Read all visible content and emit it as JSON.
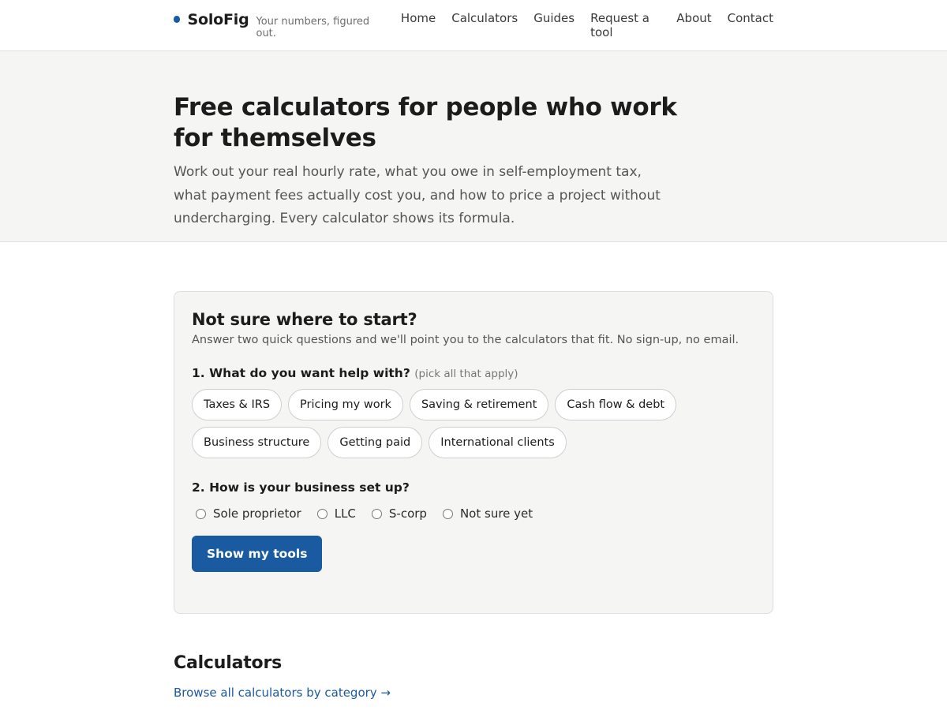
{
  "header": {
    "brand_name": "SoloFig",
    "tagline": "Your numbers, figured out.",
    "nav": [
      "Home",
      "Calculators",
      "Guides",
      "Request a tool",
      "About",
      "Contact"
    ]
  },
  "hero": {
    "title": "Free calculators for people who work for themselves",
    "description": "Work out your real hourly rate, what you owe in self-employment tax, what payment fees actually cost you, and how to price a project without undercharging. Every calculator shows its formula."
  },
  "finder": {
    "title": "Not sure where to start?",
    "subtitle": "Answer two quick questions and we'll point you to the calculators that fit. No sign-up, no email.",
    "q1_label": "1. What do you want help with?",
    "q1_hint": "(pick all that apply)",
    "topics": [
      "Taxes & IRS",
      "Pricing my work",
      "Saving & retirement",
      "Cash flow & debt",
      "Business structure",
      "Getting paid",
      "International clients"
    ],
    "q2_label": "2. How is your business set up?",
    "structures": [
      "Sole proprietor",
      "LLC",
      "S-corp",
      "Not sure yet"
    ],
    "submit_label": "Show my tools"
  },
  "calculators": {
    "title": "Calculators",
    "browse_link": "Browse all calculators by category →"
  },
  "colors": {
    "accent": "#1a5aa0",
    "panel_bg": "#f5f5f4",
    "border": "#dedede"
  }
}
